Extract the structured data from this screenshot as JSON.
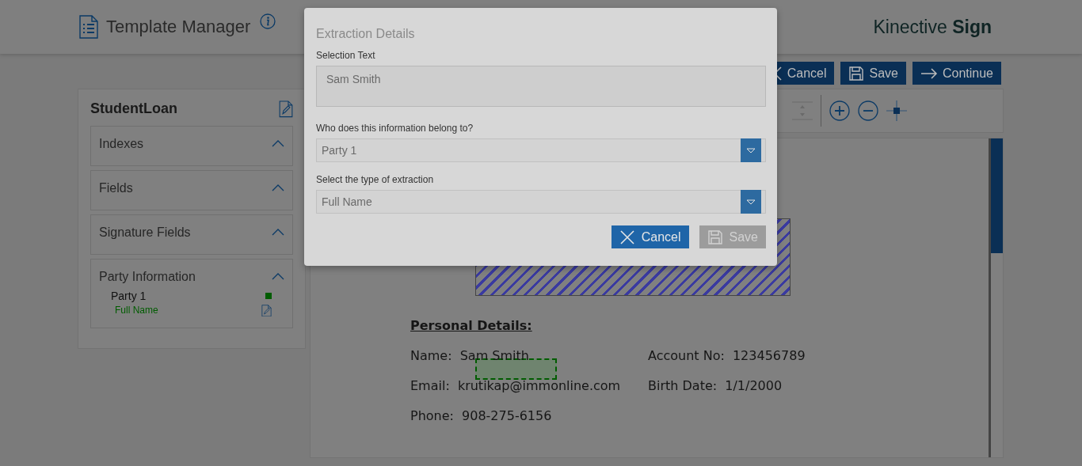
{
  "header": {
    "title": "Template Manager",
    "brand": "Kinective **Sign**"
  },
  "actions": [
    {
      "label": "Cancel",
      "kind": "cancel"
    },
    {
      "label": "Save",
      "kind": "save"
    },
    {
      "label": "Continue",
      "kind": "continue"
    }
  ],
  "template": {
    "name": "StudentLoan",
    "sections": [
      {
        "title": "Indexes",
        "expanded": true
      },
      {
        "title": "Fields",
        "expanded": true
      },
      {
        "title": "Signature Fields",
        "expanded": true
      },
      {
        "title": "Party Information",
        "expanded": true,
        "parties": [
          {
            "name": "Party 1",
            "color": "#005c00",
            "fields": [
              "Full Name"
            ]
          }
        ]
      }
    ]
  },
  "document": {
    "heading": "Personal Details:",
    "rows": [
      [
        {
          "label": "Name:",
          "value": "Sam Smith"
        },
        {
          "label": "Account No:",
          "value": "123456789"
        }
      ],
      [
        {
          "label": "Email:",
          "value": "krutikap@immonline.com"
        },
        {
          "label": "Birth Date:",
          "value": "1/1/2000"
        }
      ],
      [
        {
          "label": "Phone:",
          "value": "908-275-6156"
        }
      ]
    ]
  },
  "dialog": {
    "title": "Extraction Details",
    "fields": [
      {
        "label": "Selection Text",
        "kind": "text",
        "value": "Sam Smith"
      },
      {
        "label": "Who does this information belong to?",
        "kind": "select",
        "value": "Party 1"
      },
      {
        "label": "Select the type of extraction",
        "kind": "select",
        "value": "Full Name"
      }
    ],
    "buttons": [
      {
        "label": "Cancel",
        "kind": "cancel",
        "disabled": false
      },
      {
        "label": "Save",
        "kind": "save",
        "disabled": true
      }
    ]
  }
}
